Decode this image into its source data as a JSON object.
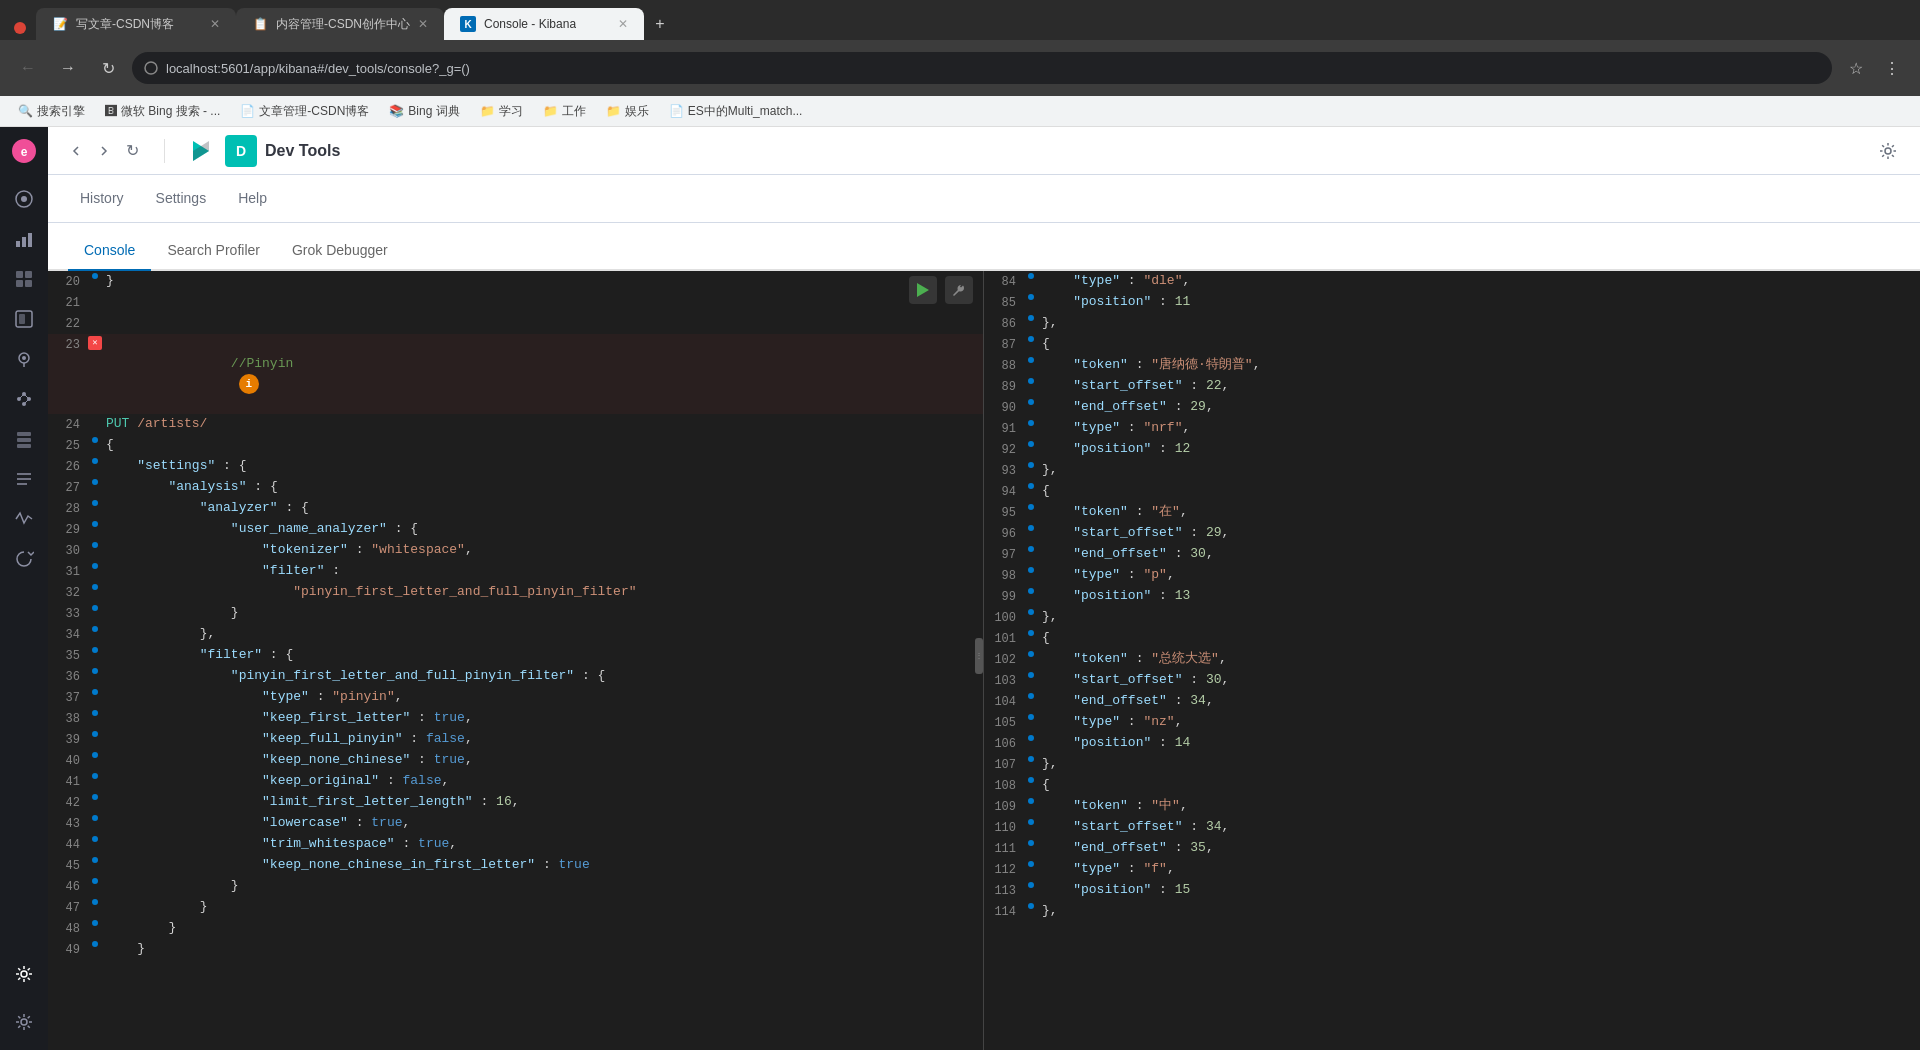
{
  "browser": {
    "tabs": [
      {
        "id": "tab1",
        "title": "写文章-CSDN博客",
        "favicon": "📝",
        "active": false
      },
      {
        "id": "tab2",
        "title": "内容管理-CSDN创作中心",
        "favicon": "📋",
        "active": false
      },
      {
        "id": "tab3",
        "title": "Console - Kibana",
        "favicon": "🔷",
        "active": true
      }
    ],
    "url": "localhost:5601/app/kibana#/dev_tools/console?_g=()",
    "bookmarks": [
      {
        "label": "搜索引擎",
        "icon": "🔍"
      },
      {
        "label": "微软 Bing 搜索 - ...",
        "icon": "🅱"
      },
      {
        "label": "文章管理-CSDN博客",
        "icon": "📄"
      },
      {
        "label": "Bing 词典",
        "icon": "📚"
      },
      {
        "label": "学习",
        "icon": "📁"
      },
      {
        "label": "工作",
        "icon": "📁"
      },
      {
        "label": "娱乐",
        "icon": "📁"
      },
      {
        "label": "ES中的Multi_match...",
        "icon": "📄"
      }
    ]
  },
  "kibana": {
    "app_title": "Dev Tools",
    "brand_letter": "D",
    "nav_items": [
      {
        "label": "History",
        "active": false
      },
      {
        "label": "Settings",
        "active": false
      },
      {
        "label": "Help",
        "active": false
      }
    ],
    "tabs": [
      {
        "label": "Console",
        "active": true
      },
      {
        "label": "Search Profiler",
        "active": false
      },
      {
        "label": "Grok Debugger",
        "active": false
      }
    ]
  },
  "sidebar_icons": [
    {
      "name": "discover-icon",
      "symbol": "🔭",
      "active": false
    },
    {
      "name": "visualize-icon",
      "symbol": "📊",
      "active": false
    },
    {
      "name": "dashboard-icon",
      "symbol": "⊞",
      "active": false
    },
    {
      "name": "canvas-icon",
      "symbol": "◧",
      "active": false
    },
    {
      "name": "maps-icon",
      "symbol": "⊙",
      "active": false
    },
    {
      "name": "ml-icon",
      "symbol": "⋮⋮",
      "active": false
    },
    {
      "name": "infrastructure-icon",
      "symbol": "⬡",
      "active": false
    },
    {
      "name": "logs-icon",
      "symbol": "≡",
      "active": false
    },
    {
      "name": "apm-icon",
      "symbol": "◈",
      "active": false
    },
    {
      "name": "uptime-icon",
      "symbol": "♡",
      "active": false
    },
    {
      "name": "dev-tools-icon",
      "symbol": "⚙",
      "active": true
    },
    {
      "name": "settings-gear-icon",
      "symbol": "⚙",
      "active": false
    }
  ],
  "left_panel": {
    "lines": [
      {
        "num": 20,
        "gutter": "dot",
        "content": "}"
      },
      {
        "num": 21,
        "gutter": "",
        "content": ""
      },
      {
        "num": 22,
        "gutter": "",
        "content": ""
      },
      {
        "num": 23,
        "gutter": "error",
        "content": "//Pinyin"
      },
      {
        "num": 24,
        "gutter": "",
        "content": "PUT /artists/"
      },
      {
        "num": 25,
        "gutter": "dot",
        "content": "{"
      },
      {
        "num": 26,
        "gutter": "dot",
        "content": "    \"settings\" : {"
      },
      {
        "num": 27,
        "gutter": "dot",
        "content": "        \"analysis\" : {"
      },
      {
        "num": 28,
        "gutter": "dot",
        "content": "            \"analyzer\" : {"
      },
      {
        "num": 29,
        "gutter": "dot",
        "content": "                \"user_name_analyzer\" : {"
      },
      {
        "num": 30,
        "gutter": "dot",
        "content": "                    \"tokenizer\" : \"whitespace\","
      },
      {
        "num": 31,
        "gutter": "dot",
        "content": "                    \"filter\" :"
      },
      {
        "num": 32,
        "gutter": "dot",
        "content": "                        \"pinyin_first_letter_and_full_pinyin_filter\""
      },
      {
        "num": 33,
        "gutter": "dot",
        "content": "                }"
      },
      {
        "num": 34,
        "gutter": "dot",
        "content": "            },"
      },
      {
        "num": 35,
        "gutter": "dot",
        "content": "            \"filter\" : {"
      },
      {
        "num": 36,
        "gutter": "dot",
        "content": "                \"pinyin_first_letter_and_full_pinyin_filter\" : {"
      },
      {
        "num": 37,
        "gutter": "dot",
        "content": "                    \"type\" : \"pinyin\","
      },
      {
        "num": 38,
        "gutter": "dot",
        "content": "                    \"keep_first_letter\" : true,"
      },
      {
        "num": 39,
        "gutter": "dot",
        "content": "                    \"keep_full_pinyin\" : false,"
      },
      {
        "num": 40,
        "gutter": "dot",
        "content": "                    \"keep_none_chinese\" : true,"
      },
      {
        "num": 41,
        "gutter": "dot",
        "content": "                    \"keep_original\" : false,"
      },
      {
        "num": 42,
        "gutter": "dot",
        "content": "                    \"limit_first_letter_length\" : 16,"
      },
      {
        "num": 43,
        "gutter": "dot",
        "content": "                    \"lowercase\" : true,"
      },
      {
        "num": 44,
        "gutter": "dot",
        "content": "                    \"trim_whitespace\" : true,"
      },
      {
        "num": 45,
        "gutter": "dot",
        "content": "                    \"keep_none_chinese_in_first_letter\" : true"
      },
      {
        "num": 46,
        "gutter": "dot",
        "content": "                }"
      },
      {
        "num": 47,
        "gutter": "dot",
        "content": "            }"
      },
      {
        "num": 48,
        "gutter": "dot",
        "content": "        }"
      },
      {
        "num": 49,
        "gutter": "dot",
        "content": "    }"
      }
    ]
  },
  "right_panel": {
    "lines": [
      {
        "num": 84,
        "gutter": "dot",
        "content": "    \"type\" : \"dle\","
      },
      {
        "num": 85,
        "gutter": "dot",
        "content": "    \"position\" : 11"
      },
      {
        "num": 86,
        "gutter": "dot",
        "content": "},"
      },
      {
        "num": 87,
        "gutter": "dot",
        "content": "{"
      },
      {
        "num": 88,
        "gutter": "dot",
        "content": "    \"token\" : \"唐纳德·特朗普\","
      },
      {
        "num": 89,
        "gutter": "dot",
        "content": "    \"start_offset\" : 22,"
      },
      {
        "num": 90,
        "gutter": "dot",
        "content": "    \"end_offset\" : 29,"
      },
      {
        "num": 91,
        "gutter": "dot",
        "content": "    \"type\" : \"nrf\","
      },
      {
        "num": 92,
        "gutter": "dot",
        "content": "    \"position\" : 12"
      },
      {
        "num": 93,
        "gutter": "dot",
        "content": "},"
      },
      {
        "num": 94,
        "gutter": "dot",
        "content": "{"
      },
      {
        "num": 95,
        "gutter": "dot",
        "content": "    \"token\" : \"在\","
      },
      {
        "num": 96,
        "gutter": "dot",
        "content": "    \"start_offset\" : 29,"
      },
      {
        "num": 97,
        "gutter": "dot",
        "content": "    \"end_offset\" : 30,"
      },
      {
        "num": 98,
        "gutter": "dot",
        "content": "    \"type\" : \"p\","
      },
      {
        "num": 99,
        "gutter": "dot",
        "content": "    \"position\" : 13"
      },
      {
        "num": 100,
        "gutter": "dot",
        "content": "},"
      },
      {
        "num": 101,
        "gutter": "dot",
        "content": "{"
      },
      {
        "num": 102,
        "gutter": "dot",
        "content": "    \"token\" : \"总统大选\","
      },
      {
        "num": 103,
        "gutter": "dot",
        "content": "    \"start_offset\" : 30,"
      },
      {
        "num": 104,
        "gutter": "dot",
        "content": "    \"end_offset\" : 34,"
      },
      {
        "num": 105,
        "gutter": "dot",
        "content": "    \"type\" : \"nz\","
      },
      {
        "num": 106,
        "gutter": "dot",
        "content": "    \"position\" : 14"
      },
      {
        "num": 107,
        "gutter": "dot",
        "content": "},"
      },
      {
        "num": 108,
        "gutter": "dot",
        "content": "{"
      },
      {
        "num": 109,
        "gutter": "dot",
        "content": "    \"token\" : \"中\","
      },
      {
        "num": 110,
        "gutter": "dot",
        "content": "    \"start_offset\" : 34,"
      },
      {
        "num": 111,
        "gutter": "dot",
        "content": "    \"end_offset\" : 35,"
      },
      {
        "num": 112,
        "gutter": "dot",
        "content": "    \"type\" : \"f\","
      },
      {
        "num": 113,
        "gutter": "dot",
        "content": "    \"position\" : 15"
      },
      {
        "num": 114,
        "gutter": "dot",
        "content": "},"
      }
    ]
  }
}
